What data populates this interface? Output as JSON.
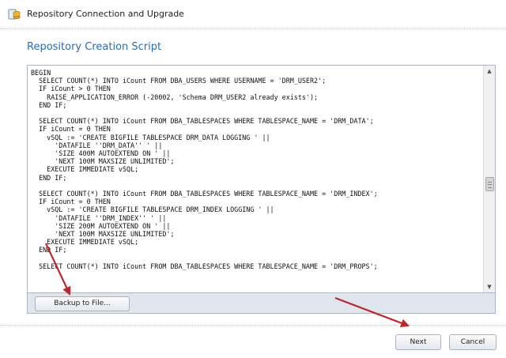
{
  "window": {
    "title": "Repository Connection and Upgrade",
    "icon": "repository-database-icon"
  },
  "page": {
    "heading": "Repository Creation Script"
  },
  "script": {
    "text": "BEGIN\n  SELECT COUNT(*) INTO iCount FROM DBA_USERS WHERE USERNAME = 'DRM_USER2';\n  IF iCount > 0 THEN\n    RAISE_APPLICATION_ERROR (-20002, 'Schema DRM_USER2 already exists');\n  END IF;\n\n  SELECT COUNT(*) INTO iCount FROM DBA_TABLESPACES WHERE TABLESPACE_NAME = 'DRM_DATA';\n  IF iCount = 0 THEN\n    vSQL := 'CREATE BIGFILE TABLESPACE DRM_DATA LOGGING ' ||\n      'DATAFILE ''DRM_DATA'' ' ||\n      'SIZE 400M AUTOEXTEND ON ' ||\n      'NEXT 100M MAXSIZE UNLIMITED';\n    EXECUTE IMMEDIATE vSQL;\n  END IF;\n\n  SELECT COUNT(*) INTO iCount FROM DBA_TABLESPACES WHERE TABLESPACE_NAME = 'DRM_INDEX';\n  IF iCount = 0 THEN\n    vSQL := 'CREATE BIGFILE TABLESPACE DRM_INDEX LOGGING ' ||\n      'DATAFILE ''DRM_INDEX'' ' ||\n      'SIZE 200M AUTOEXTEND ON ' ||\n      'NEXT 100M MAXSIZE UNLIMITED';\n    EXECUTE IMMEDIATE vSQL;\n  END IF;\n\n  SELECT COUNT(*) INTO iCount FROM DBA_TABLESPACES WHERE TABLESPACE_NAME = 'DRM_PROPS';"
  },
  "buttons": {
    "backup": "Backup to File...",
    "next": "Next",
    "cancel": "Cancel"
  },
  "annotations": {
    "arrow_color": "#c0272d"
  },
  "colors": {
    "heading": "#2a6db3",
    "bottom_bar": "#dfe6ee"
  }
}
